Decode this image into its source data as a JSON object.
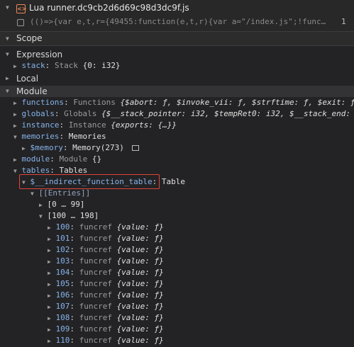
{
  "header": {
    "filename": "Lua runner.dc9cb2d6d69c98d3dc9f.js",
    "file_icon_glyph": "<>",
    "snippet": "(()=>{var e,t,r={49455:function(e,t,r){var a=\"/index.js\";!func…",
    "line": "1"
  },
  "scope": {
    "title": "Scope"
  },
  "sections": {
    "expression": "Expression",
    "local": "Local",
    "module": "Module"
  },
  "expression": {
    "key": "stack",
    "value_type": "Stack",
    "value": "{0: i32}"
  },
  "module": {
    "functions": {
      "key": "functions",
      "type": "Functions",
      "preview": "{$abort: ƒ, $invoke_vii: ƒ, $strftime: ƒ, $exit: ƒ"
    },
    "globals": {
      "key": "globals",
      "type": "Globals",
      "preview": "{$__stack_pointer: i32, $tempRet0: i32, $__stack_end: i3"
    },
    "instance": {
      "key": "instance",
      "type": "Instance",
      "preview": "{exports: {…}}"
    },
    "memories": {
      "key": "memories",
      "type": "Memories"
    },
    "memory": {
      "key": "$memory",
      "value": "Memory(273)"
    },
    "module_item": {
      "key": "module",
      "type": "Module",
      "preview": "{}"
    },
    "tables": {
      "key": "tables",
      "type": "Tables"
    },
    "table": {
      "key": "$__indirect_function_table",
      "type": "Table"
    },
    "entries_label": "[[Entries]]",
    "range1": "[0 … 99]",
    "range2": "[100 … 198]",
    "entry_type": "funcref",
    "entry_value": "{value: ƒ}",
    "entries": [
      "100",
      "101",
      "102",
      "103",
      "104",
      "105",
      "106",
      "107",
      "108",
      "109",
      "110"
    ]
  }
}
